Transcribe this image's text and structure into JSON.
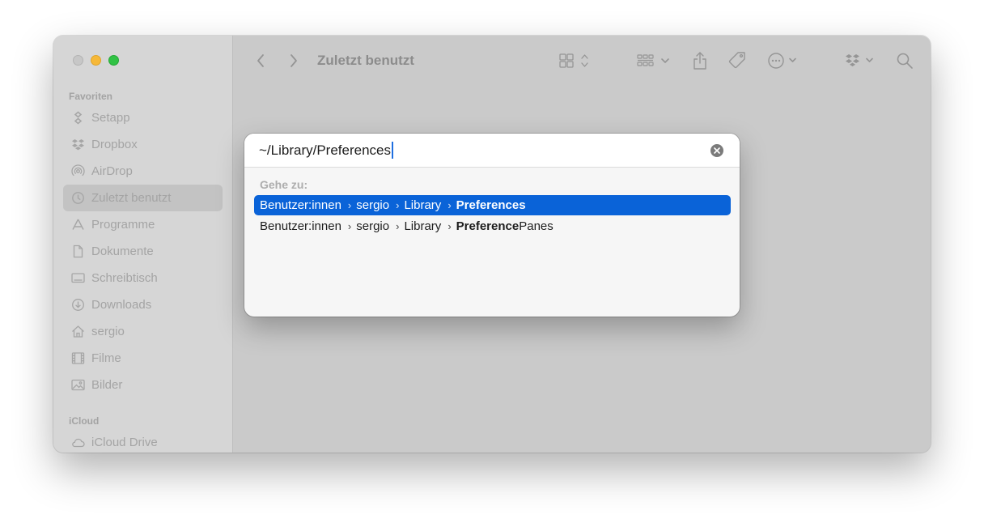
{
  "window": {
    "title": "Zuletzt benutzt"
  },
  "sidebar": {
    "sections": [
      {
        "label": "Favoriten"
      },
      {
        "label": "iCloud"
      }
    ],
    "items": [
      {
        "label": "Setapp",
        "icon": "setapp-icon"
      },
      {
        "label": "Dropbox",
        "icon": "dropbox-icon"
      },
      {
        "label": "AirDrop",
        "icon": "airdrop-icon"
      },
      {
        "label": "Zuletzt benutzt",
        "icon": "clock-icon",
        "active": true
      },
      {
        "label": "Programme",
        "icon": "apps-icon"
      },
      {
        "label": "Dokumente",
        "icon": "document-icon"
      },
      {
        "label": "Schreibtisch",
        "icon": "desktop-icon"
      },
      {
        "label": "Downloads",
        "icon": "download-icon"
      },
      {
        "label": "sergio",
        "icon": "home-icon"
      },
      {
        "label": "Filme",
        "icon": "film-icon"
      },
      {
        "label": "Bilder",
        "icon": "photo-icon"
      },
      {
        "label": "iCloud Drive",
        "icon": "cloud-icon"
      }
    ]
  },
  "goto_dialog": {
    "path_value": "~/Library/Preferences",
    "section_label": "Gehe zu:",
    "results": [
      {
        "parts": [
          "Benutzer:innen",
          "sergio",
          "Library"
        ],
        "match": "Preferences",
        "suffix": "",
        "selected": true
      },
      {
        "parts": [
          "Benutzer:innen",
          "sergio",
          "Library"
        ],
        "match": "Preference",
        "suffix": "Panes",
        "suffix_tail": "s",
        "selected": false
      }
    ]
  },
  "colors": {
    "selection": "#0a63d8",
    "close": "#c7c7c7",
    "minimize": "#f6b838",
    "maximize": "#31c245"
  }
}
